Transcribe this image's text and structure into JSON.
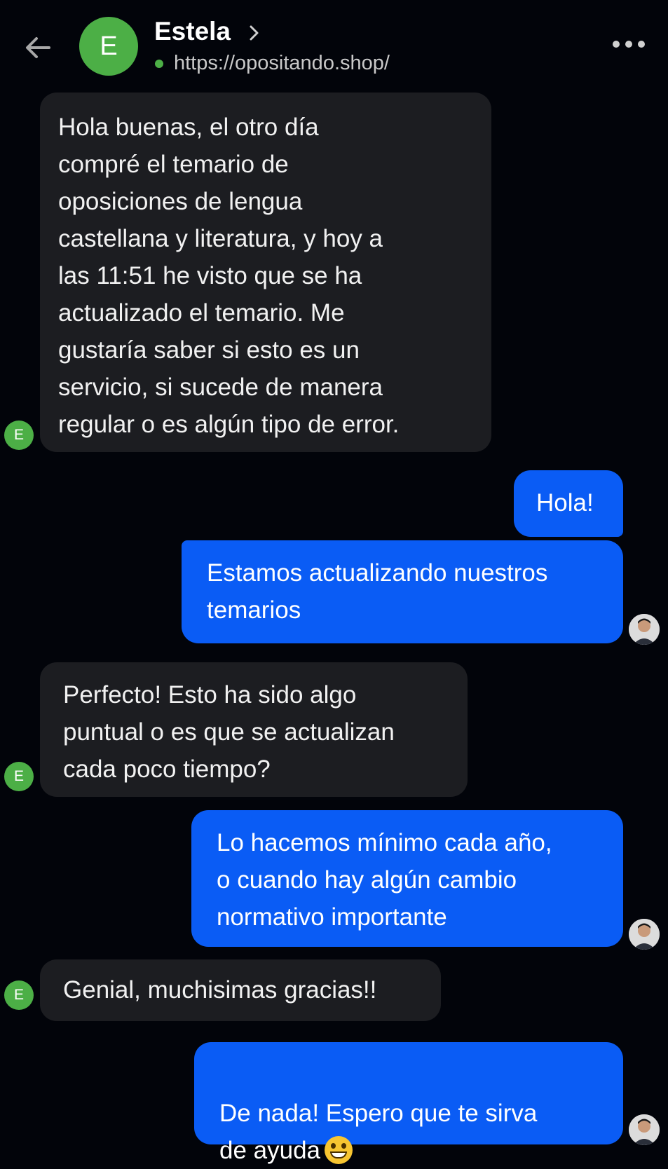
{
  "header": {
    "back_icon": "arrow-left-icon",
    "avatar_initial": "E",
    "name": "Estela",
    "url": "https://opositando.shop/",
    "status_color": "#4caf46",
    "more_icon": "more-horizontal-icon"
  },
  "colors": {
    "background": "#02040a",
    "incoming_bubble": "#1c1d21",
    "outgoing_bubble": "#0a5cf5",
    "avatar": "#4caf46"
  },
  "messages": [
    {
      "from": "customer",
      "text": "Hola buenas, el otro día\ncompré el temario de\noposiciones de lengua\ncastellana y literatura, y hoy a\nlas 11:51 he visto que se ha\nactualizado el temario. Me\ngustaría saber si esto es un\nservicio, si sucede de manera\nregular o es algún tipo de error."
    },
    {
      "from": "agent",
      "text": "Hola!"
    },
    {
      "from": "agent",
      "text": "Estamos actualizando nuestros\ntemarios"
    },
    {
      "from": "customer",
      "text": "Perfecto! Esto ha sido algo\npuntual o es que se actualizan\ncada poco tiempo?"
    },
    {
      "from": "agent",
      "text": "Lo hacemos mínimo cada año,\no cuando hay algún cambio\nnormativo importante"
    },
    {
      "from": "customer",
      "text": "Genial, muchisimas gracias!!"
    },
    {
      "from": "agent",
      "text": "De nada! Espero que te sirva\nde ayuda",
      "emoji": "grinning-face-icon"
    }
  ],
  "customer_avatar_initial": "E"
}
